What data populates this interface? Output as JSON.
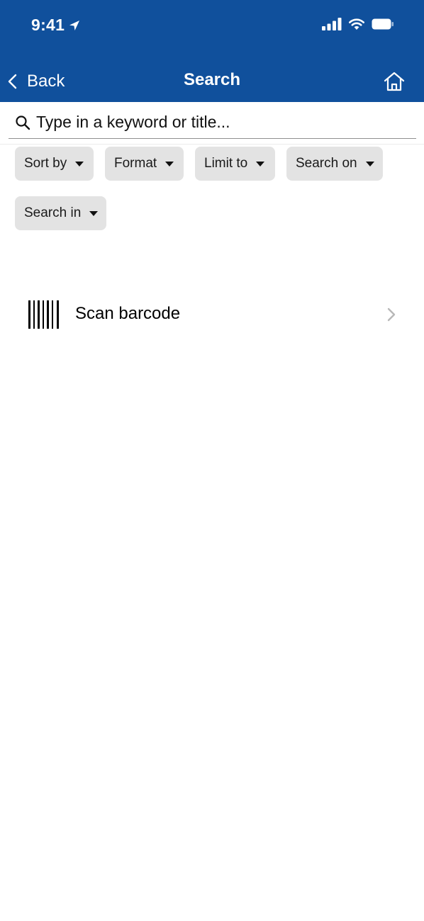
{
  "status_bar": {
    "time": "9:41"
  },
  "nav": {
    "back_label": "Back",
    "title": "Search"
  },
  "search": {
    "placeholder": "Type in a keyword or title..."
  },
  "filters": {
    "sort_by": "Sort by",
    "format": "Format",
    "limit_to": "Limit to",
    "search_on": "Search on",
    "search_in": "Search in"
  },
  "scan": {
    "label": "Scan barcode"
  },
  "colors": {
    "header_bg": "#10509c",
    "chip_bg": "#e3e3e3"
  },
  "icons": {
    "status": [
      "location-arrow-icon",
      "signal-icon",
      "wifi-icon",
      "battery-icon"
    ],
    "nav": [
      "chevron-left-icon",
      "home-icon"
    ],
    "search": "search-icon",
    "scan": [
      "barcode-icon",
      "chevron-right-icon"
    ]
  }
}
